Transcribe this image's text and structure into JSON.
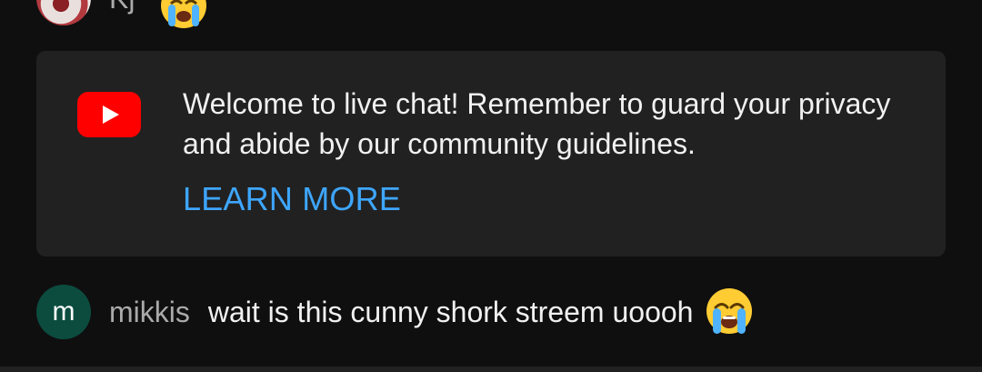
{
  "chat": {
    "previous_message": {
      "author": "Kj",
      "emoji": "loudly-crying-face"
    },
    "banner": {
      "message": "Welcome to live chat! Remember to guard your privacy and abide by our community guidelines.",
      "link_label": "LEARN MORE",
      "logo": "youtube-logo"
    },
    "messages": [
      {
        "avatar_letter": "m",
        "author": "mikkis",
        "text": "wait is this cunny shork streem uoooh",
        "emoji": "loudly-crying-face"
      }
    ]
  },
  "colors": {
    "background": "#0f0f0f",
    "banner_background": "#212121",
    "link": "#3ea6ff",
    "author": "#aaaaaa",
    "text": "#f1f1f1",
    "youtube_red": "#ff0000",
    "avatar_m": "#0b4c3f"
  }
}
